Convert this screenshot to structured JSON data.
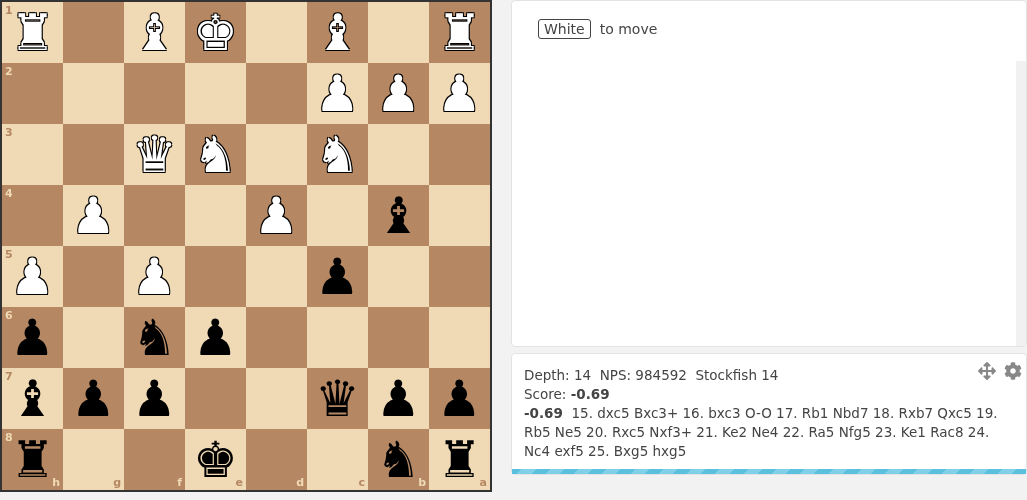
{
  "board": {
    "ranks": [
      {
        "label": "1",
        "squares": [
          {
            "piece": "♜",
            "kind": "white"
          },
          {
            "kind": "empty"
          },
          {
            "piece": "♝",
            "kind": "white"
          },
          {
            "piece": "♚",
            "kind": "white"
          },
          {
            "kind": "empty"
          },
          {
            "piece": "♝",
            "kind": "white"
          },
          {
            "kind": "empty"
          },
          {
            "piece": "♜",
            "kind": "white"
          }
        ]
      },
      {
        "label": "2",
        "squares": [
          {
            "kind": "empty"
          },
          {
            "kind": "empty"
          },
          {
            "kind": "empty"
          },
          {
            "kind": "empty"
          },
          {
            "kind": "empty"
          },
          {
            "piece": "♟",
            "kind": "white"
          },
          {
            "piece": "♟",
            "kind": "white"
          },
          {
            "piece": "♟",
            "kind": "white"
          }
        ]
      },
      {
        "label": "3",
        "squares": [
          {
            "kind": "empty"
          },
          {
            "kind": "empty"
          },
          {
            "piece": "♛",
            "kind": "white"
          },
          {
            "piece": "♞",
            "kind": "white"
          },
          {
            "kind": "empty"
          },
          {
            "piece": "♞",
            "kind": "white"
          },
          {
            "kind": "empty"
          },
          {
            "kind": "empty"
          }
        ]
      },
      {
        "label": "4",
        "squares": [
          {
            "kind": "empty"
          },
          {
            "piece": "♟",
            "kind": "white"
          },
          {
            "kind": "empty"
          },
          {
            "kind": "empty"
          },
          {
            "piece": "♟",
            "kind": "white"
          },
          {
            "kind": "empty"
          },
          {
            "piece": "♝",
            "kind": "black"
          },
          {
            "kind": "empty"
          }
        ]
      },
      {
        "label": "5",
        "squares": [
          {
            "piece": "♟",
            "kind": "white"
          },
          {
            "kind": "empty"
          },
          {
            "piece": "♟",
            "kind": "white"
          },
          {
            "kind": "empty"
          },
          {
            "kind": "empty"
          },
          {
            "piece": "♟",
            "kind": "black"
          },
          {
            "kind": "empty"
          },
          {
            "kind": "empty"
          }
        ]
      },
      {
        "label": "6",
        "squares": [
          {
            "piece": "♟",
            "kind": "black"
          },
          {
            "kind": "empty"
          },
          {
            "piece": "♞",
            "kind": "black"
          },
          {
            "piece": "♟",
            "kind": "black"
          },
          {
            "kind": "empty"
          },
          {
            "kind": "empty"
          },
          {
            "kind": "empty"
          },
          {
            "kind": "empty"
          }
        ]
      },
      {
        "label": "7",
        "squares": [
          {
            "piece": "♝",
            "kind": "black"
          },
          {
            "piece": "♟",
            "kind": "black"
          },
          {
            "piece": "♟",
            "kind": "black"
          },
          {
            "kind": "empty"
          },
          {
            "kind": "empty"
          },
          {
            "piece": "♛",
            "kind": "black"
          },
          {
            "piece": "♟",
            "kind": "black"
          },
          {
            "piece": "♟",
            "kind": "black"
          }
        ]
      },
      {
        "label": "8",
        "squares": [
          {
            "piece": "♜",
            "kind": "black"
          },
          {
            "kind": "empty"
          },
          {
            "kind": "empty"
          },
          {
            "piece": "♚",
            "kind": "black"
          },
          {
            "kind": "empty"
          },
          {
            "kind": "empty"
          },
          {
            "piece": "♞",
            "kind": "black"
          },
          {
            "piece": "♜",
            "kind": "black"
          }
        ]
      }
    ],
    "files": [
      "h",
      "g",
      "f",
      "e",
      "d",
      "c",
      "b",
      "a"
    ]
  },
  "turn": {
    "side": "White",
    "label": "to move"
  },
  "engine": {
    "stats": "Depth: 14  NPS: 984592  Stockfish 14",
    "score": "Score: **-0.69**",
    "line": "**-0.69**  15. dxc5 Bxc3+ 16. bxc3 O-O 17. Rb1 Nbd7 18. Rxb7 Qxc5 19. Rb5 Ne5 20. Rxc5 Nxf3+ 21. Ke2 Ne4 22. Ra5 Nfg5 23. Ke1 Rac8 24. Nc4 exf5 25. Bxg5 hxg5",
    "level": 1
  }
}
